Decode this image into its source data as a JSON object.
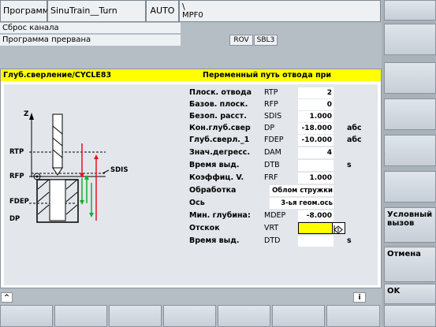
{
  "header": {
    "mode_label": "Программа",
    "program_name": "SinuTrain__Turn",
    "auto_label": "AUTO",
    "path_slash": "\\",
    "path_name": "MPF0"
  },
  "status": {
    "line1": "Сброс канала",
    "line2": "Программа прервана",
    "rov": "ROV",
    "sbl": "SBL3"
  },
  "dialog": {
    "title_left": "Глуб.сверление/CYCLE83",
    "title_right": "Переменный путь отвода при стружколомке",
    "params": [
      {
        "label": "Плоск. отвода",
        "abbr": "RTP",
        "value": "2",
        "unit": ""
      },
      {
        "label": "Базов. плоск.",
        "abbr": "RFP",
        "value": "0",
        "unit": ""
      },
      {
        "label": "Безоп. расст.",
        "abbr": "SDIS",
        "value": "1.000",
        "unit": ""
      },
      {
        "label": "Кон.глуб.свер",
        "abbr": "DP",
        "value": "-18.000",
        "unit": "абс"
      },
      {
        "label": "Глуб.сверл._1",
        "abbr": "FDEP",
        "value": "-10.000",
        "unit": "абс"
      },
      {
        "label": "Знач.дегресс.",
        "abbr": "DAM",
        "value": "4",
        "unit": ""
      },
      {
        "label": "Время выд.",
        "abbr": "DTB",
        "value": "",
        "unit": "s"
      },
      {
        "label": "Коэффиц. V.",
        "abbr": "FRF",
        "value": "1.000",
        "unit": ""
      },
      {
        "label": "Обработка",
        "abbr": "",
        "value": "Облом стружки",
        "unit": ""
      },
      {
        "label": "Ось",
        "abbr": "",
        "value": "3-ья геом.ось",
        "unit": ""
      },
      {
        "label": "Мин. глубина:",
        "abbr": "MDEP",
        "value": "-8.000",
        "unit": ""
      },
      {
        "label": "Отскок",
        "abbr": "VRT",
        "value": "",
        "unit": ""
      },
      {
        "label": "Время выд.",
        "abbr": "DTD",
        "value": "",
        "unit": "s"
      }
    ],
    "diagram_labels": {
      "z": "Z",
      "rtp": "RTP",
      "rfp": "RFP",
      "fdep": "FDEP",
      "dp": "DP",
      "sdis": "SDIS"
    }
  },
  "bottom": {
    "up_arrow": "^",
    "info": "i"
  },
  "softkeys": {
    "conditional_call": "Условный вызов",
    "cancel": "Отмена",
    "ok": "OK"
  },
  "colors": {
    "dialog_title_bg": "#ffff00",
    "active_field": "#ffff00",
    "arrow_red": "#e8121c",
    "arrow_green": "#10b030",
    "background": "#b5bdc5"
  }
}
